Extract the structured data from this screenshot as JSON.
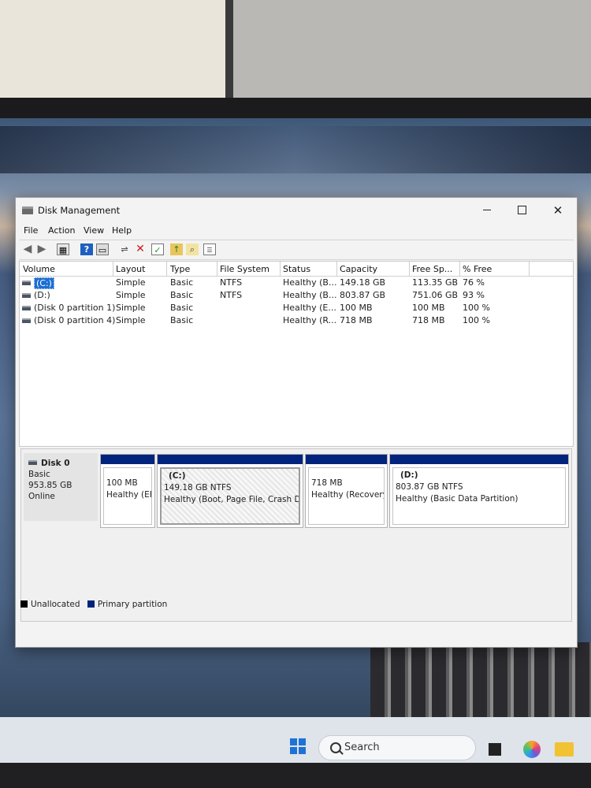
{
  "window": {
    "title": "Disk Management"
  },
  "menu": [
    "File",
    "Action",
    "View",
    "Help"
  ],
  "volume_table": {
    "headers": [
      "Volume",
      "Layout",
      "Type",
      "File System",
      "Status",
      "Capacity",
      "Free Sp...",
      "% Free"
    ],
    "rows": [
      {
        "volume": "(C:)",
        "layout": "Simple",
        "type": "Basic",
        "fs": "NTFS",
        "status": "Healthy (B...",
        "capacity": "149.18 GB",
        "free": "113.35 GB",
        "pct": "76 %"
      },
      {
        "volume": "(D:)",
        "layout": "Simple",
        "type": "Basic",
        "fs": "NTFS",
        "status": "Healthy (B...",
        "capacity": "803.87 GB",
        "free": "751.06 GB",
        "pct": "93 %"
      },
      {
        "volume": "(Disk 0 partition 1)",
        "layout": "Simple",
        "type": "Basic",
        "fs": "",
        "status": "Healthy (E...",
        "capacity": "100 MB",
        "free": "100 MB",
        "pct": "100 %"
      },
      {
        "volume": "(Disk 0 partition 4)",
        "layout": "Simple",
        "type": "Basic",
        "fs": "",
        "status": "Healthy (R...",
        "capacity": "718 MB",
        "free": "718 MB",
        "pct": "100 %"
      }
    ]
  },
  "disk0": {
    "name": "Disk 0",
    "kind": "Basic",
    "size": "953.85 GB",
    "state": "Online",
    "partitions": [
      {
        "letter": "",
        "size": "100 MB",
        "status": "Healthy (EFI"
      },
      {
        "letter": "(C:)",
        "size": "149.18 GB NTFS",
        "status": "Healthy (Boot, Page File, Crash Dum"
      },
      {
        "letter": "",
        "size": "718 MB",
        "status": "Healthy (Recovery"
      },
      {
        "letter": "(D:)",
        "size": "803.87 GB NTFS",
        "status": "Healthy (Basic Data Partition)"
      }
    ]
  },
  "legend": {
    "unallocated": "Unallocated",
    "primary": "Primary partition",
    "unallocated_color": "#000000",
    "primary_color": "#00237d"
  },
  "taskbar": {
    "search_label": "Search"
  }
}
